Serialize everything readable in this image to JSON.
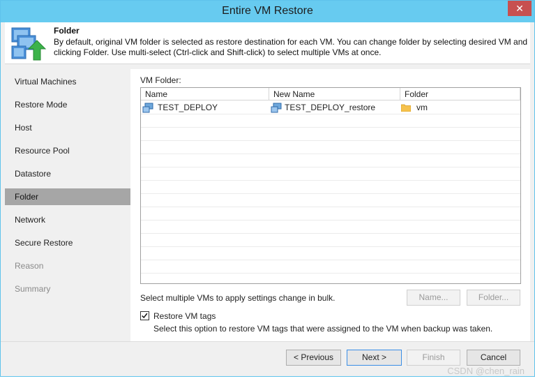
{
  "window": {
    "title": "Entire VM Restore"
  },
  "header": {
    "title": "Folder",
    "description": "By default, original VM folder is selected as restore destination for each VM. You can change folder by selecting desired VM and clicking Folder. Use multi-select (Ctrl-click and Shift-click) to select multiple VMs at once."
  },
  "nav": {
    "items": [
      {
        "label": "Virtual Machines",
        "state": "normal"
      },
      {
        "label": "Restore Mode",
        "state": "normal"
      },
      {
        "label": "Host",
        "state": "normal"
      },
      {
        "label": "Resource Pool",
        "state": "normal"
      },
      {
        "label": "Datastore",
        "state": "normal"
      },
      {
        "label": "Folder",
        "state": "active"
      },
      {
        "label": "Network",
        "state": "normal"
      },
      {
        "label": "Secure Restore",
        "state": "normal"
      },
      {
        "label": "Reason",
        "state": "disabled"
      },
      {
        "label": "Summary",
        "state": "disabled"
      }
    ]
  },
  "main": {
    "vm_folder_label": "VM Folder:",
    "columns": [
      "Name",
      "New Name",
      "Folder"
    ],
    "rows": [
      {
        "name": "TEST_DEPLOY",
        "new_name": "TEST_DEPLOY_restore",
        "folder": "vm"
      }
    ],
    "bulk_hint": "Select multiple VMs to apply settings change in bulk.",
    "name_button": "Name...",
    "folder_button": "Folder...",
    "restore_tags": {
      "label": "Restore VM tags",
      "checked": true,
      "description": "Select this option to restore VM tags that were assigned to the VM when backup was taken."
    }
  },
  "footer": {
    "previous": "< Previous",
    "next": "Next >",
    "finish": "Finish",
    "cancel": "Cancel"
  },
  "watermark": "CSDN @chen_rain",
  "colors": {
    "titlebar": "#67cbf0",
    "close": "#c75050",
    "active_nav": "#a6a6a6"
  }
}
